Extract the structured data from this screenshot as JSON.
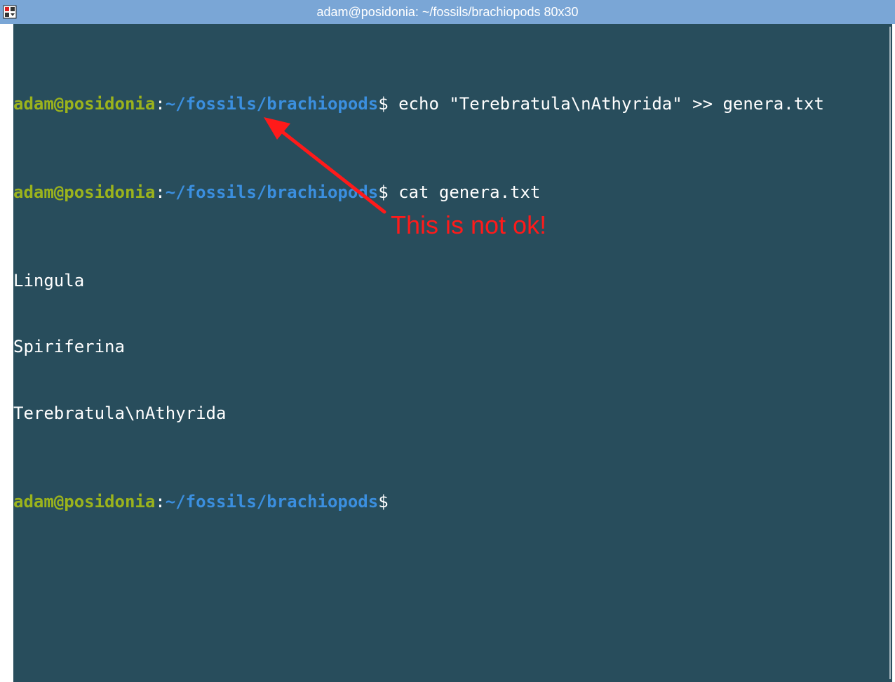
{
  "window": {
    "title": "adam@posidonia: ~/fossils/brachiopods 80x30",
    "menu_icon": "window-menu-icon"
  },
  "terminal": {
    "colors": {
      "background": "#284d5c",
      "user_host": "#9bb31c",
      "path": "#3b8fdf",
      "text": "#ffffff"
    },
    "lines": [
      {
        "type": "prompt",
        "user_host": "adam@posidonia",
        "colon": ":",
        "path": "~/fossils/brachiopods",
        "dollar": "$",
        "command": " echo \"Terebratula\\nAthyrida\" >> genera.txt"
      },
      {
        "type": "prompt",
        "user_host": "adam@posidonia",
        "colon": ":",
        "path": "~/fossils/brachiopods",
        "dollar": "$",
        "command": " cat genera.txt"
      },
      {
        "type": "output",
        "text": "Lingula"
      },
      {
        "type": "output",
        "text": "Spiriferina"
      },
      {
        "type": "output",
        "text": "Terebratula\\nAthyrida"
      },
      {
        "type": "prompt",
        "user_host": "adam@posidonia",
        "colon": ":",
        "path": "~/fossils/brachiopods",
        "dollar": "$",
        "command": ""
      }
    ]
  },
  "annotation": {
    "text": "This is not ok!",
    "color": "#ff1a1a"
  }
}
